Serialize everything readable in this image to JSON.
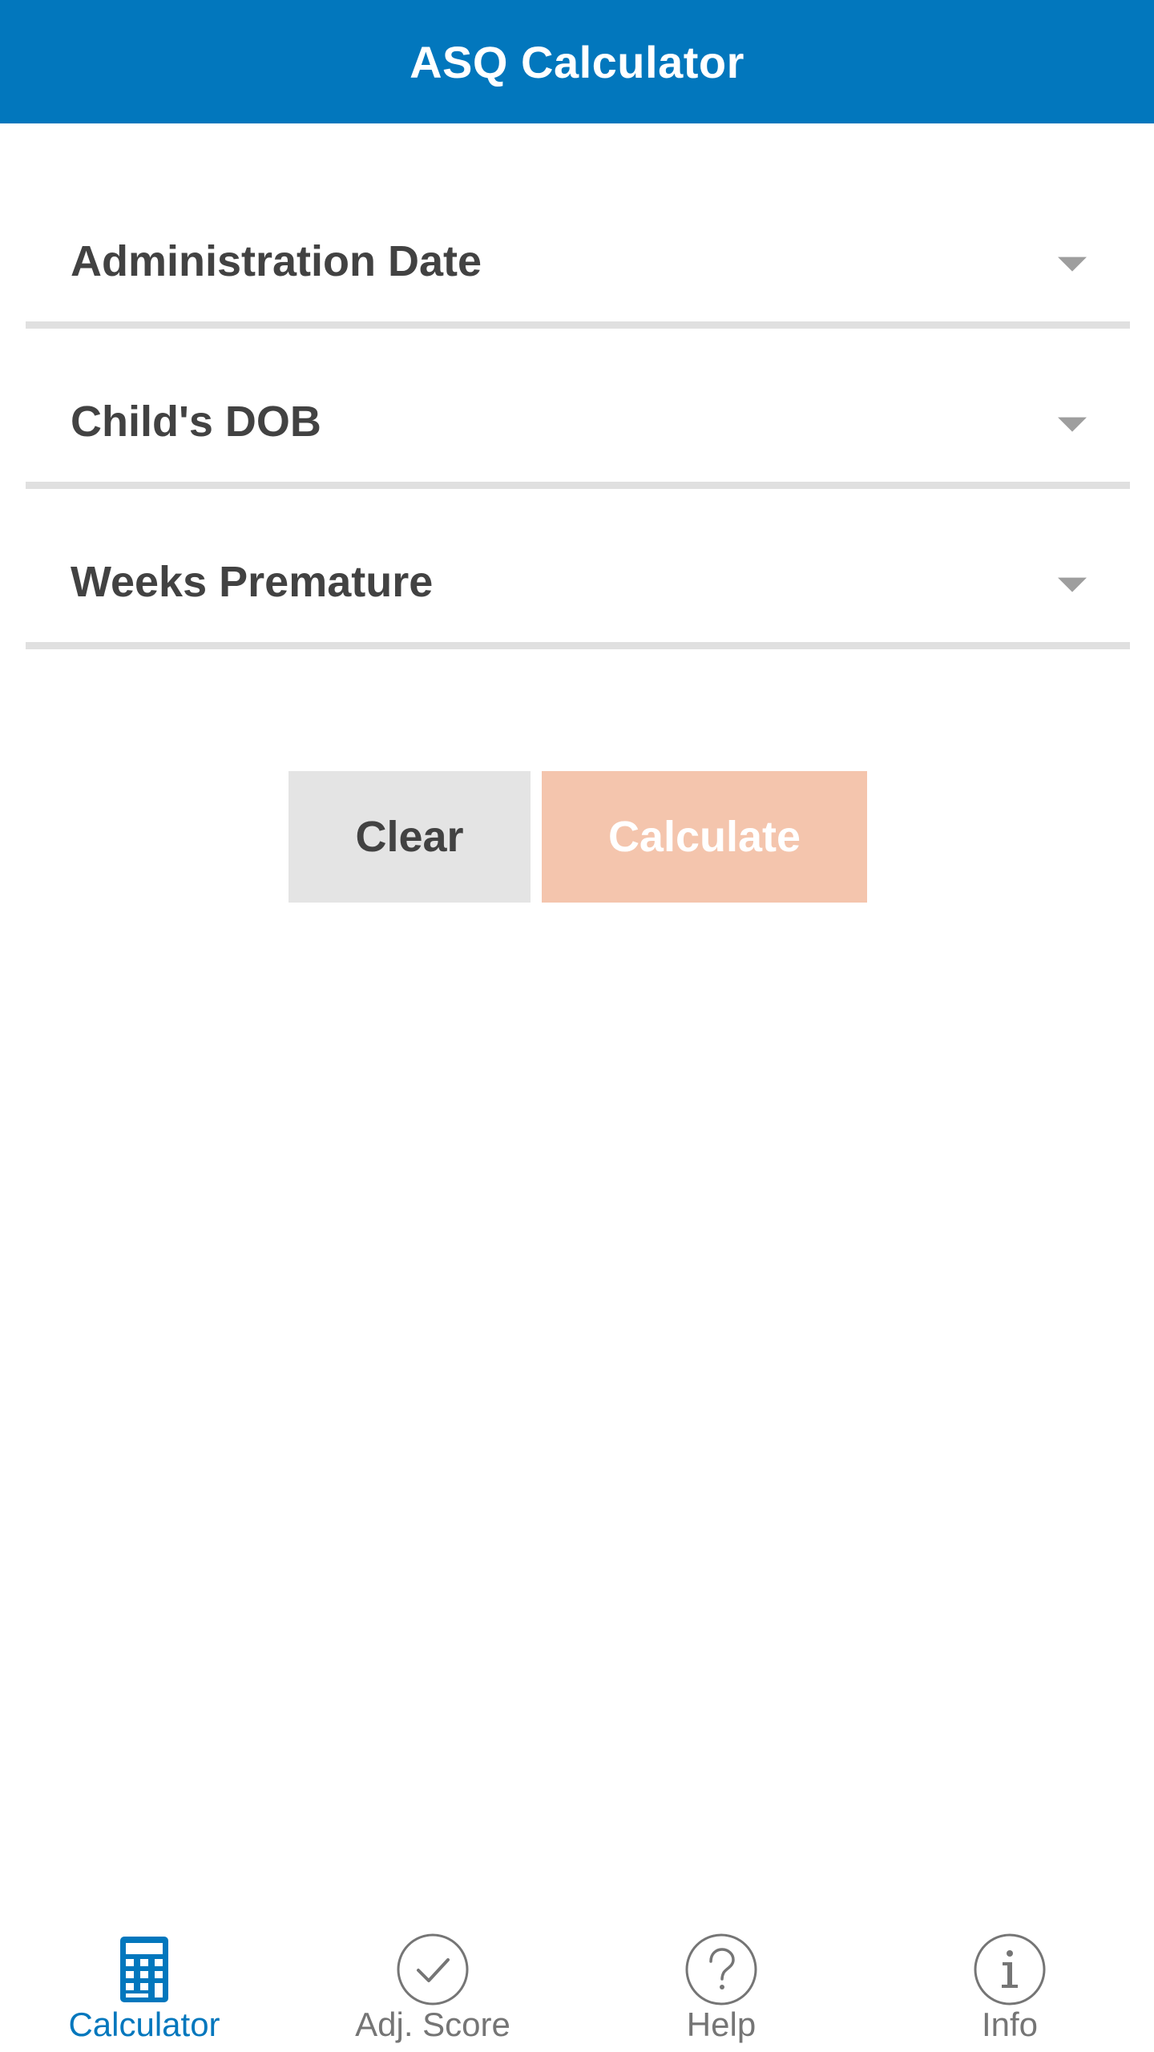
{
  "app": {
    "title": "ASQ Calculator"
  },
  "form": {
    "fields": [
      {
        "label": "Administration Date"
      },
      {
        "label": "Child's DOB"
      },
      {
        "label": "Weeks Premature"
      }
    ],
    "clear_label": "Clear",
    "calculate_label": "Calculate"
  },
  "bottom_nav": {
    "items": [
      {
        "label": "Calculator",
        "icon": "calculator-icon",
        "active": true
      },
      {
        "label": "Adj. Score",
        "icon": "check-circle-icon",
        "active": false
      },
      {
        "label": "Help",
        "icon": "help-circle-icon",
        "active": false
      },
      {
        "label": "Info",
        "icon": "info-circle-icon",
        "active": false
      }
    ]
  },
  "colors": {
    "primary": "#0277bd",
    "calculate_button": "#f4c5ad",
    "clear_button": "#e4e4e4",
    "field_text": "#424242",
    "divider": "#e0e0e0",
    "inactive_nav": "#757575"
  }
}
